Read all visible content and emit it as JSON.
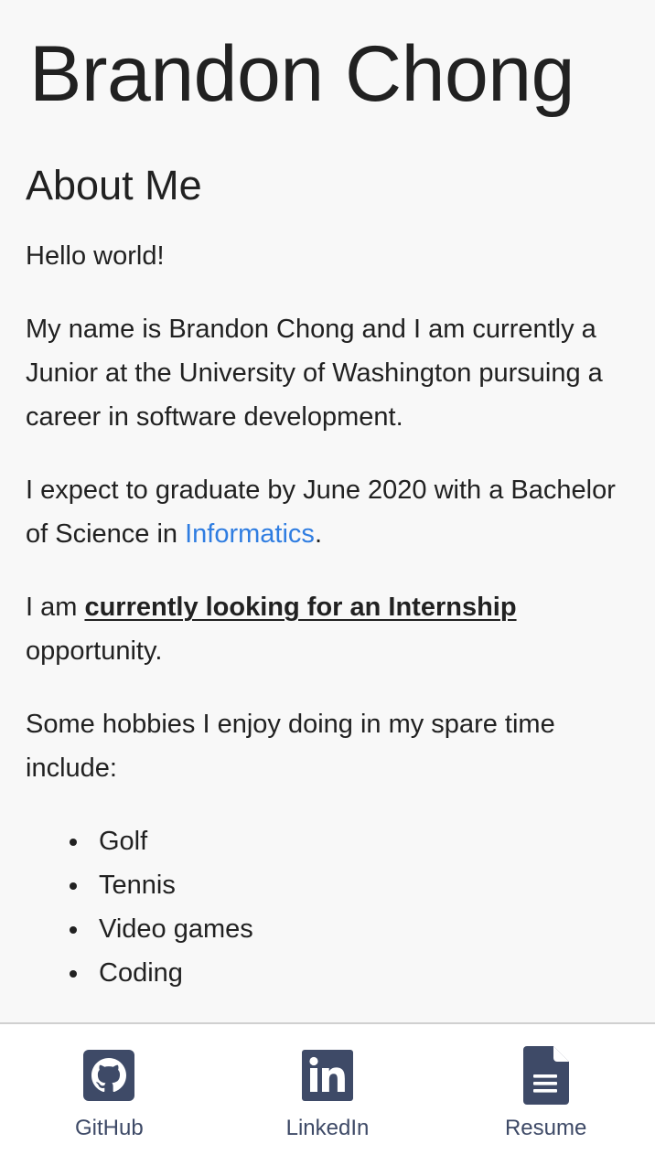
{
  "header": {
    "title": "Brandon Chong"
  },
  "about": {
    "heading": "About Me",
    "hello": "Hello world!",
    "intro": "My name is Brandon Chong and I am currently a Junior at the University of Washington pursuing a career in software development.",
    "graduate_prefix": "I expect to graduate by June 2020 with a Bachelor of Science in ",
    "graduate_link": "Informatics",
    "graduate_suffix": ".",
    "internship_prefix": "I am ",
    "internship_emphasis": "currently looking for an Internship",
    "internship_suffix": " opportunity.",
    "hobbies_intro": "Some hobbies I enjoy doing in my spare time include:",
    "hobbies": [
      "Golf",
      "Tennis",
      "Video games",
      "Coding"
    ]
  },
  "nav": {
    "github": {
      "label": "GitHub",
      "icon": "github-icon"
    },
    "linkedin": {
      "label": "LinkedIn",
      "icon": "linkedin-icon"
    },
    "resume": {
      "label": "Resume",
      "icon": "document-icon"
    }
  },
  "colors": {
    "background": "#f8f8f8",
    "text": "#212121",
    "link": "#2f7de1",
    "nav_icon": "#3e4a67"
  }
}
